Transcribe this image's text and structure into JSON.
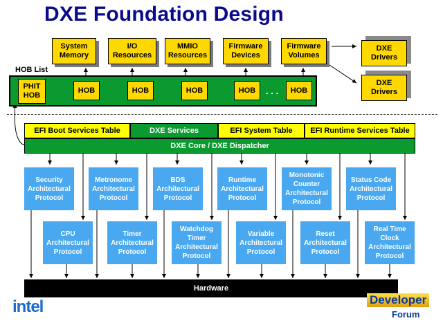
{
  "title": "DXE Foundation Design",
  "resources": [
    "System\nMemory",
    "I/O\nResources",
    "MMIO\nResources",
    "Firmware\nDevices",
    "Firmware\nVolumes"
  ],
  "drivers": [
    "DXE\nDrivers",
    "DXE\nDrivers"
  ],
  "hob_list_label": "HOB List",
  "hob_first": "PHIT\nHOB",
  "hob_item": "HOB",
  "hob_ellipsis": ". . .",
  "service_tables": [
    "EFI Boot Services Table",
    "DXE Services",
    "EFI System Table",
    "EFI Runtime Services Table"
  ],
  "core": "DXE Core / DXE Dispatcher",
  "protocols_top": [
    "Security\nArchitectural\nProtocol",
    "Metronome\nArchitectural\nProtocol",
    "BDS\nArchitectural\nProtocol",
    "Runtime\nArchitectural\nProtocol",
    "Monotonic\nCounter\nArchitectural\nProtocol",
    "Status Code\nArchitectural\nProtocol"
  ],
  "protocols_bottom": [
    "CPU\nArchitectural\nProtocol",
    "Timer\nArchitectural\nProtocol",
    "Watchdog\nTimer\nArchitectural\nProtocol",
    "Variable\nArchitectural\nProtocol",
    "Reset\nArchitectural\nProtocol",
    "Real Time\nClock\nArchitectural\nProtocol"
  ],
  "hardware": "Hardware",
  "logo_intel": "intel",
  "logo_idf_1": "Developer",
  "logo_idf_2": "Forum",
  "colors": {
    "title": "#0a0a8c",
    "yellow_box": "#ffd800",
    "green": "#0a9a30",
    "protocol_blue": "#4aa8f0",
    "service_yellow": "#ffff00"
  }
}
